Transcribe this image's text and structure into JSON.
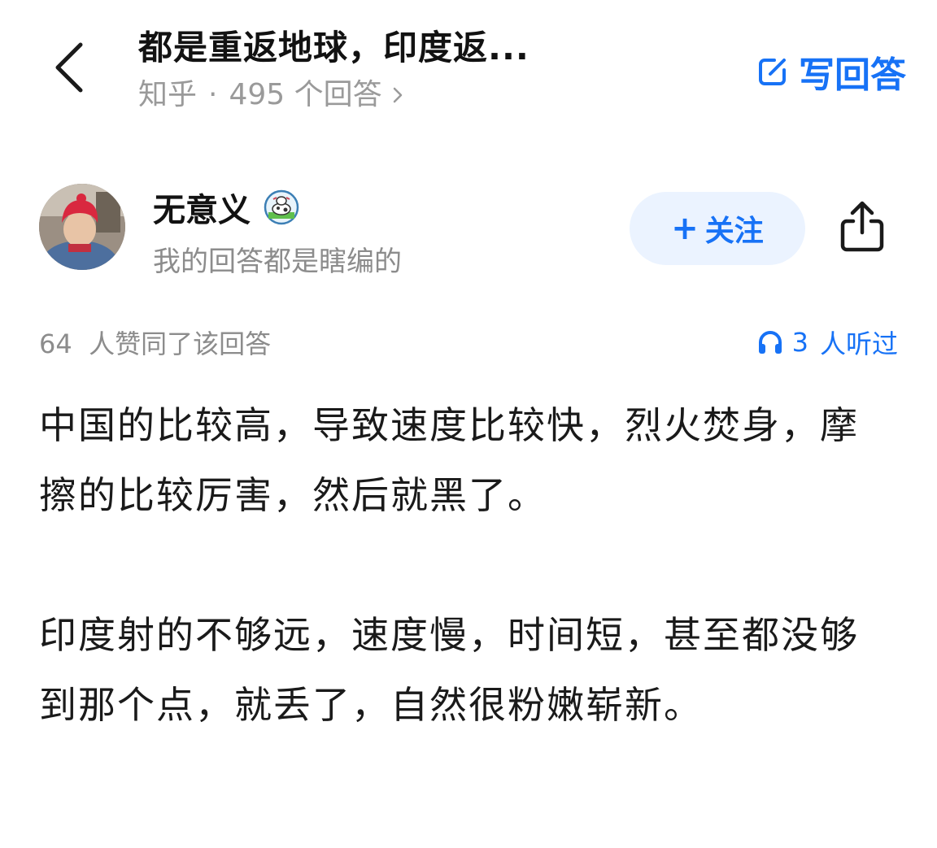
{
  "header": {
    "back_icon": "chevron-left-icon",
    "title": "都是重返地球，印度返...",
    "source": "知乎",
    "separator": "·",
    "answer_count": "495 个回答",
    "chevron_icon": "chevron-right-icon",
    "write_answer_label": "写回答",
    "write_answer_icon": "edit-icon"
  },
  "author": {
    "avatar_icon": "avatar",
    "name": "无意义",
    "badge_icon": "cow-badge-icon",
    "bio": "我的回答都是瞎编的",
    "follow_label": "关注",
    "follow_prefix": "+",
    "share_icon": "share-icon"
  },
  "stats": {
    "upvotes_text": "64  人赞同了该回答",
    "listen_icon": "headphones-icon",
    "listen_count": "3",
    "listen_label": "人听过"
  },
  "answer": {
    "paragraphs": [
      "中国的比较高，导致速度比较快，烈火焚身，摩擦的比较厉害，然后就黑了。",
      "印度射的不够远，速度慢，时间短，甚至都没够到那个点，就丢了，自然很粉嫩崭新。"
    ]
  },
  "colors": {
    "accent": "#1772f6",
    "follow_bg": "#ebf3ff",
    "muted_text": "#8c8c8c",
    "body_text": "#1a1a1a"
  }
}
